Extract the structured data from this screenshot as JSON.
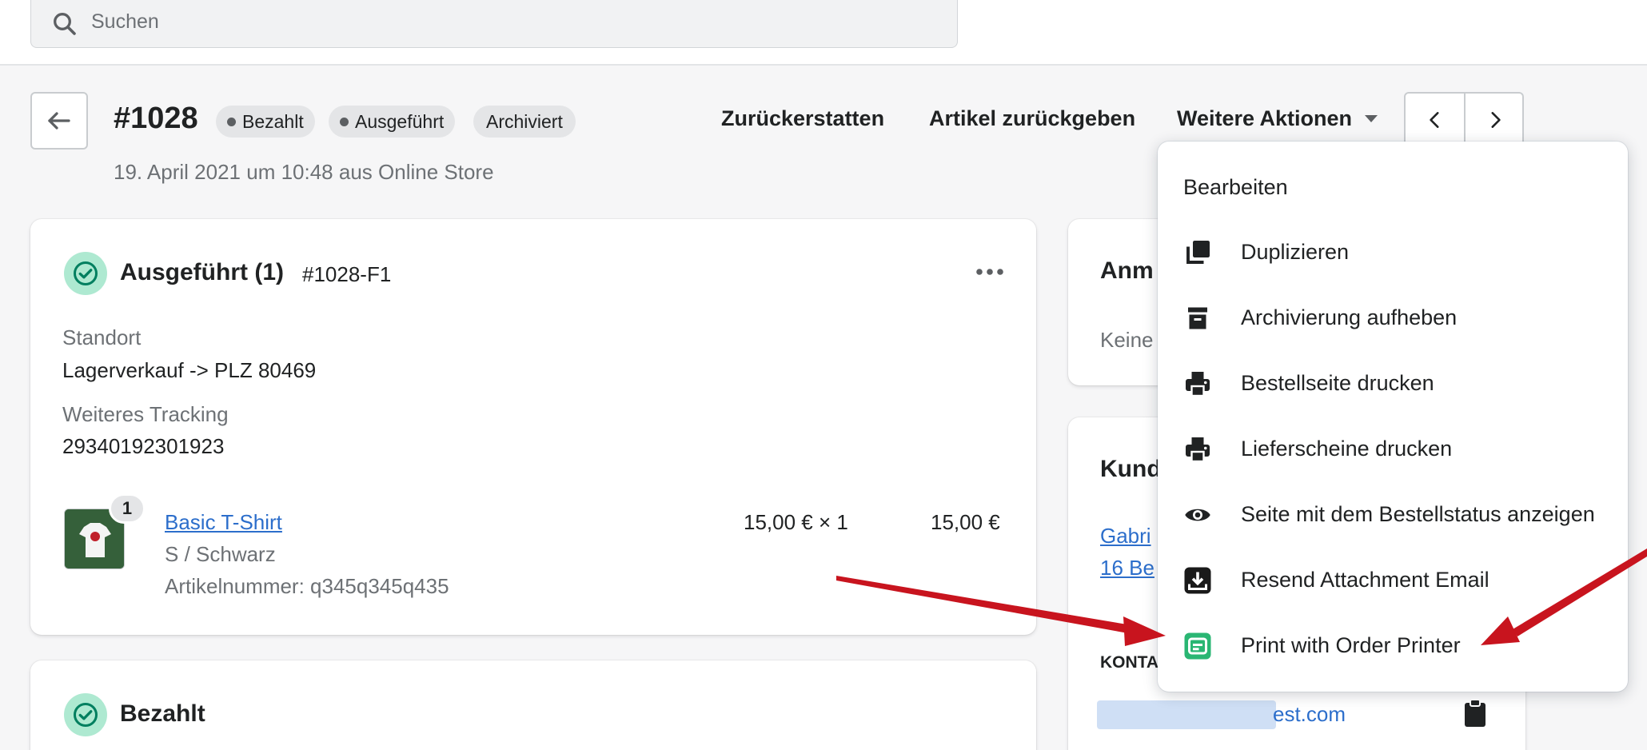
{
  "search": {
    "placeholder": "Suchen"
  },
  "order": {
    "number": "#1028",
    "badges": [
      "Bezahlt",
      "Ausgeführt",
      "Archiviert"
    ],
    "date": "19. April 2021 um 10:48 aus Online Store"
  },
  "header_actions": {
    "refund": "Zurückerstatten",
    "return_items": "Artikel zurückgeben",
    "more_actions": "Weitere Aktionen"
  },
  "fulfilled_card": {
    "title": "Ausgeführt (1)",
    "fulfillment_id": "#1028-F1",
    "location_label": "Standort",
    "location_value": "Lagerverkauf -> PLZ 80469",
    "tracking_label": "Weiteres Tracking",
    "tracking_value": "29340192301923",
    "line_item": {
      "quantity_badge": "1",
      "name": "Basic T-Shirt",
      "variant": "S / Schwarz",
      "sku": "Artikelnummer: q345q345q435",
      "price_qty": "15,00 € × 1",
      "total": "15,00 €"
    }
  },
  "paid_card": {
    "title": "Bezahlt"
  },
  "notes_card": {
    "title_partial": "Anm",
    "text_partial": "Keine"
  },
  "customer_card": {
    "title_partial": "Kund",
    "link_line1_partial": "Gabri",
    "link_line2_partial": "16 Be",
    "contact_label_partial": "KONTA",
    "email_partial_visible": "est.com"
  },
  "dropdown": {
    "header": "Bearbeiten",
    "items": [
      {
        "label": "Duplizieren",
        "icon": "duplicate-icon"
      },
      {
        "label": "Archivierung aufheben",
        "icon": "unarchive-icon"
      },
      {
        "label": "Bestellseite drucken",
        "icon": "print-icon"
      },
      {
        "label": "Lieferscheine drucken",
        "icon": "print-icon"
      },
      {
        "label": "Seite mit dem Bestellstatus anzeigen",
        "icon": "eye-icon"
      },
      {
        "label": "Resend Attachment Email",
        "icon": "download-app-icon"
      },
      {
        "label": "Print with Order Printer",
        "icon": "order-printer-app-icon"
      }
    ]
  },
  "colors": {
    "link": "#2c6ecb",
    "success_bg": "#aee9d1",
    "success_icon": "#007f5f",
    "annotation_arrow": "#c8141e",
    "order_printer_green": "#2ab673"
  }
}
